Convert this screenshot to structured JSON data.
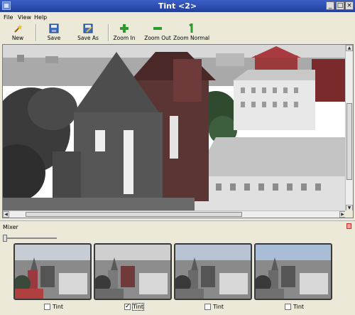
{
  "window": {
    "title": "Tint <2>",
    "minimize": "_",
    "maximize": "□",
    "close": "×"
  },
  "menu": [
    "File",
    "View",
    "Help"
  ],
  "toolbar": {
    "new_label": "New",
    "save_label": "Save",
    "save_as_label": "Save As",
    "zoom_in_label": "Zoom In",
    "zoom_out_label": "Zoom Out",
    "zoom_normal_label": "Zoom Normal"
  },
  "colors": {
    "title_bar": "#22409a",
    "zoom_icon_green": "#2c9a2c",
    "tint_highlight": "#c0303a"
  },
  "mixer": {
    "title": "Mixer",
    "tints": [
      {
        "label": "Tint",
        "checked": false
      },
      {
        "label": "Tint",
        "checked": true
      },
      {
        "label": "Tint",
        "checked": false
      },
      {
        "label": "Tint",
        "checked": false
      }
    ]
  }
}
